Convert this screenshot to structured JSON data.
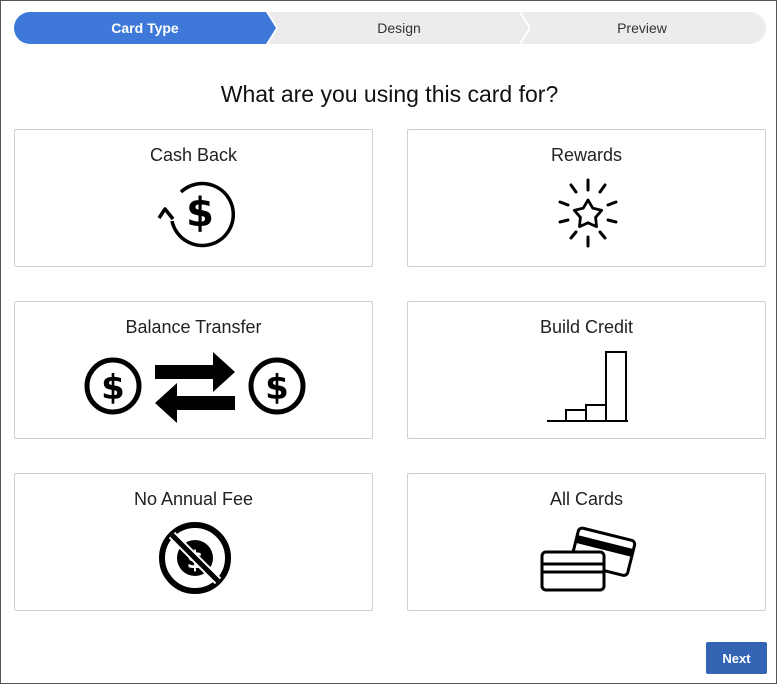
{
  "stepper": {
    "steps": [
      {
        "label": "Card Type",
        "active": true
      },
      {
        "label": "Design",
        "active": false
      },
      {
        "label": "Preview",
        "active": false
      }
    ],
    "active_color": "#3e78d8",
    "inactive_color": "#ececec"
  },
  "heading": "What are you using this card for?",
  "cards": [
    {
      "title": "Cash Back",
      "icon": "cash-back-icon"
    },
    {
      "title": "Rewards",
      "icon": "rewards-star-icon"
    },
    {
      "title": "Balance Transfer",
      "icon": "balance-transfer-icon"
    },
    {
      "title": "Build Credit",
      "icon": "build-credit-icon"
    },
    {
      "title": "No Annual Fee",
      "icon": "no-annual-fee-icon"
    },
    {
      "title": "All Cards",
      "icon": "all-cards-icon"
    }
  ],
  "next_button": {
    "label": "Next",
    "color": "#3465b4"
  }
}
